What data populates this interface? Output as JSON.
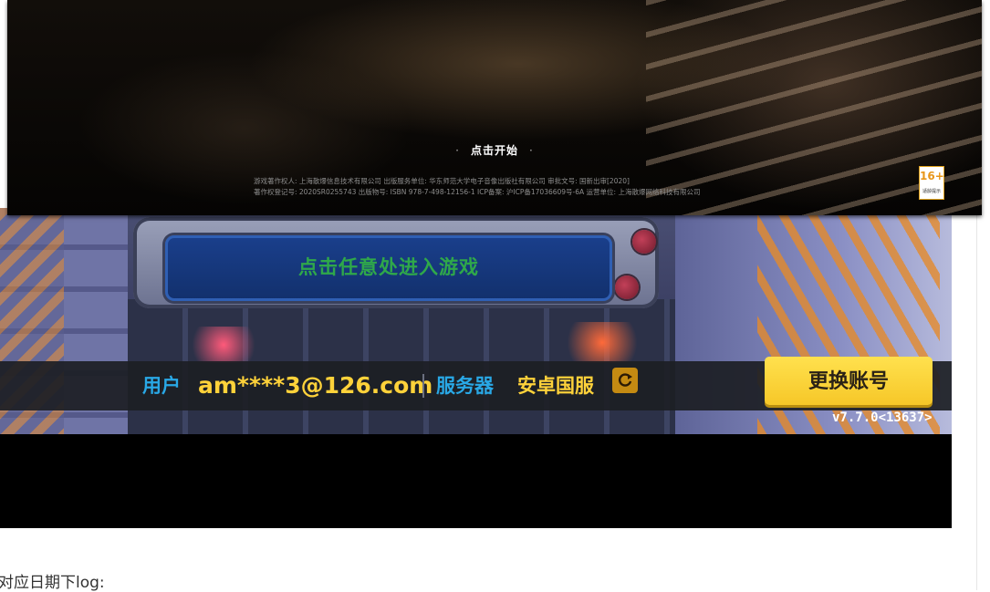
{
  "splash": {
    "start_prompt": "点击开始",
    "dot": "·",
    "legal_line1": "游戏著作权人: 上海散爆信息技术有限公司  出版服务单位: 华东师范大学电子音像出版社有限公司  审批文号: 国新出审[2020]",
    "legal_line2": "著作权登记号: 2020SR0255743  出版物号: ISBN 978-7-498-12156-1  ICP备案: 沪ICP备17036609号-6A  运营单位: 上海散爆网络科技有限公司",
    "age_rating": "16+",
    "age_rating_tag": "适龄提示"
  },
  "game": {
    "enter_prompt": "点击任意处进入游戏",
    "user_label": "用户",
    "user_value": "am****3@126.com",
    "server_label": "服务器",
    "server_value": "安卓国服",
    "switch_account": "更换账号",
    "version": "v7.7.0<13637>"
  },
  "page": {
    "caption": "对应日期下log:"
  },
  "colors": {
    "accent_blue": "#29a8e6",
    "accent_yellow": "#ffd23a",
    "button_yellow": "#f6c728",
    "enter_text_green": "#2fa84a"
  },
  "icons": [
    "refresh-icon"
  ]
}
